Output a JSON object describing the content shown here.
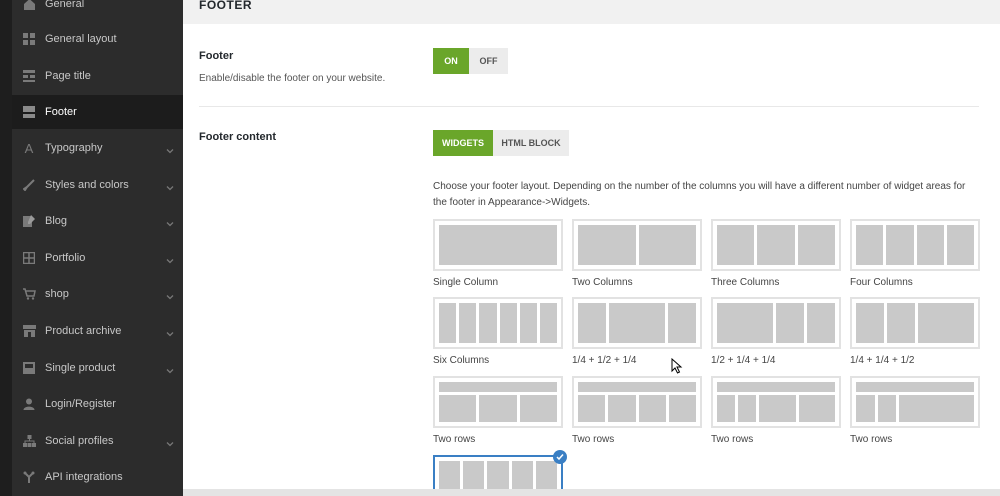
{
  "sidebar": {
    "items": [
      {
        "label": "General",
        "icon": "home-icon",
        "has_submenu": false
      },
      {
        "label": "General layout",
        "icon": "layout-grid-icon",
        "has_submenu": false
      },
      {
        "label": "Page title",
        "icon": "page-title-icon",
        "has_submenu": false
      },
      {
        "label": "Footer",
        "icon": "footer-icon",
        "has_submenu": false,
        "active": true
      },
      {
        "label": "Typography",
        "icon": "typography-icon",
        "has_submenu": true
      },
      {
        "label": "Styles and colors",
        "icon": "brush-icon",
        "has_submenu": true
      },
      {
        "label": "Blog",
        "icon": "blog-icon",
        "has_submenu": true
      },
      {
        "label": "Portfolio",
        "icon": "portfolio-icon",
        "has_submenu": true
      },
      {
        "label": "shop",
        "icon": "cart-icon",
        "has_submenu": true
      },
      {
        "label": "Product archive",
        "icon": "store-icon",
        "has_submenu": true
      },
      {
        "label": "Single product",
        "icon": "product-icon",
        "has_submenu": true
      },
      {
        "label": "Login/Register",
        "icon": "user-icon",
        "has_submenu": false
      },
      {
        "label": "Social profiles",
        "icon": "sitemap-icon",
        "has_submenu": true
      },
      {
        "label": "API integrations",
        "icon": "api-icon",
        "has_submenu": false
      }
    ]
  },
  "main": {
    "section_title": "FOOTER",
    "footer_option": {
      "label": "Footer",
      "description": "Enable/disable the footer on your website.",
      "on_label": "ON",
      "off_label": "OFF",
      "value": "ON"
    },
    "footer_content": {
      "label": "Footer content",
      "widgets_label": "WIDGETS",
      "html_block_label": "HTML BLOCK",
      "value": "WIDGETS",
      "layout_description": "Choose your footer layout. Depending on the number of the columns you will have a different number of widget areas for the footer in Appearance->Widgets.",
      "layouts": [
        {
          "name": "Single Column"
        },
        {
          "name": "Two Columns"
        },
        {
          "name": "Three Columns"
        },
        {
          "name": "Four Columns"
        },
        {
          "name": "Six Columns"
        },
        {
          "name": "1/4 + 1/2 + 1/4"
        },
        {
          "name": "1/2 + 1/4 + 1/4"
        },
        {
          "name": "1/4 + 1/4 + 1/2"
        },
        {
          "name": "Two rows"
        },
        {
          "name": "Two rows"
        },
        {
          "name": "Two rows"
        },
        {
          "name": "Two rows"
        },
        {
          "name": "",
          "selected": true
        }
      ]
    }
  },
  "colors": {
    "accent_green": "#6aa62a",
    "selected_blue": "#3a7fc4",
    "sidebar_bg": "#2c2c2c"
  }
}
